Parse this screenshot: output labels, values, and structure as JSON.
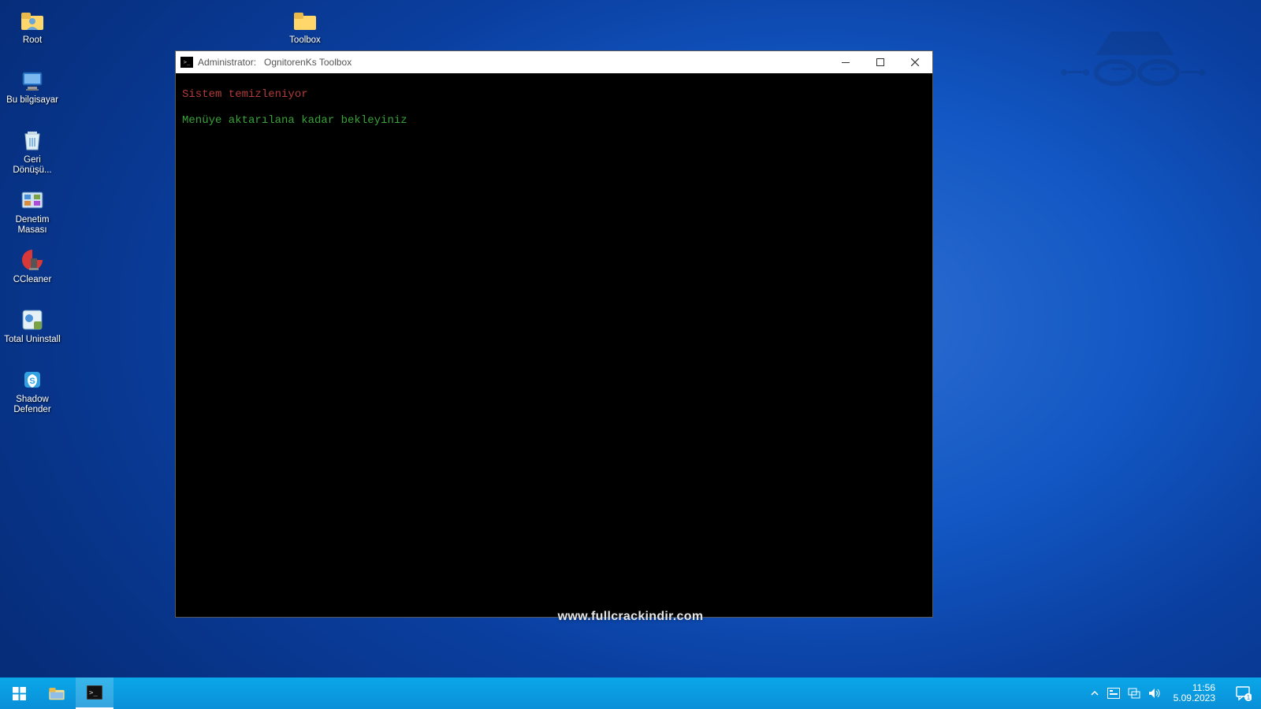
{
  "desktop_icons_left": [
    {
      "name": "root",
      "label": "Root"
    },
    {
      "name": "this-pc",
      "label": "Bu bilgisayar"
    },
    {
      "name": "recycle-bin",
      "label": "Geri Dönüşü..."
    },
    {
      "name": "control-panel",
      "label": "Denetim Masası"
    },
    {
      "name": "ccleaner",
      "label": "CCleaner"
    },
    {
      "name": "total-uninstall",
      "label": "Total Uninstall"
    },
    {
      "name": "shadow-defender",
      "label": "Shadow Defender"
    }
  ],
  "desktop_icon_toolbox": {
    "name": "toolbox",
    "label": "Toolbox"
  },
  "cmd_window": {
    "title_prefix": "Administrator:",
    "title_app": "OgnitorenKs Toolbox",
    "line1": "Sistem temizleniyor",
    "line2": "Menüye aktarılana kadar bekleyiniz"
  },
  "watermark": "www.fullcrackindir.com",
  "taskbar": {
    "time": "11:56",
    "date": "5.09.2023",
    "notification_count": "1"
  },
  "colors": {
    "accent": "#0aa7e8",
    "cmd_red": "#b13b3b",
    "cmd_green": "#38a238"
  }
}
